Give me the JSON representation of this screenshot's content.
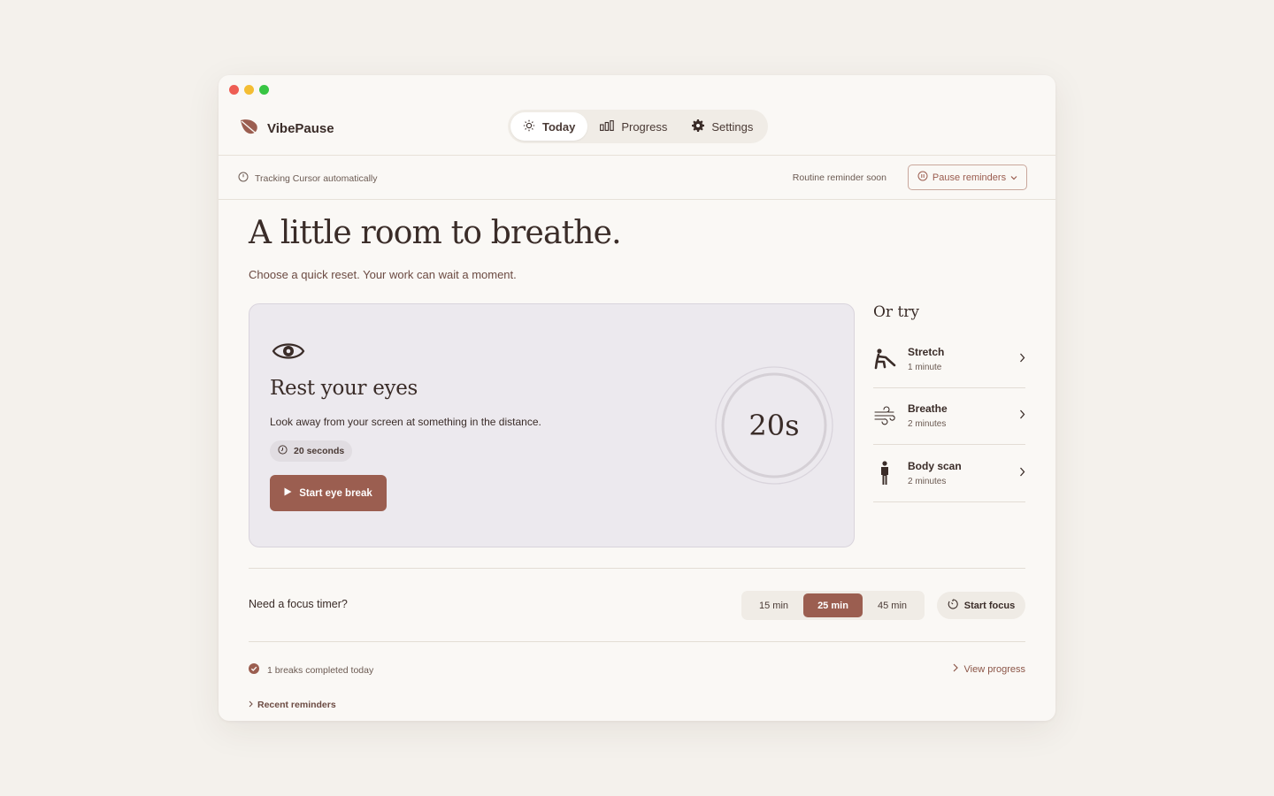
{
  "app": {
    "name": "VibePause",
    "logo_icon": "leaf-icon",
    "accent": "#9b5e50"
  },
  "nav": [
    {
      "label": "Today",
      "icon": "sun-icon",
      "active": true
    },
    {
      "label": "Progress",
      "icon": "bar-chart-icon",
      "active": false
    },
    {
      "label": "Settings",
      "icon": "gear-icon",
      "active": false
    }
  ],
  "status": {
    "tracking": "Tracking Cursor automatically",
    "reminder": "Routine reminder soon",
    "pause_button": "Pause reminders"
  },
  "hero": {
    "title": "A little room to breathe.",
    "subtitle": "Choose a quick reset. Your work can wait a moment."
  },
  "featured": {
    "icon": "eye-icon",
    "title": "Rest your eyes",
    "description": "Look away from your screen at something in the distance.",
    "duration_chip": "20 seconds",
    "button": "Start eye break",
    "timer": "20s"
  },
  "alternatives": {
    "heading": "Or try",
    "items": [
      {
        "name": "Stretch",
        "duration": "1 minute",
        "icon": "stretch-icon"
      },
      {
        "name": "Breathe",
        "duration": "2 minutes",
        "icon": "wind-icon"
      },
      {
        "name": "Body scan",
        "duration": "2 minutes",
        "icon": "person-icon"
      }
    ]
  },
  "focus": {
    "label": "Need a focus timer?",
    "options": [
      "15 min",
      "25 min",
      "45 min"
    ],
    "selected": "25 min",
    "button": "Start focus"
  },
  "footer": {
    "breaks": "1 breaks completed today",
    "view_progress": "View progress",
    "recent": "Recent reminders"
  }
}
